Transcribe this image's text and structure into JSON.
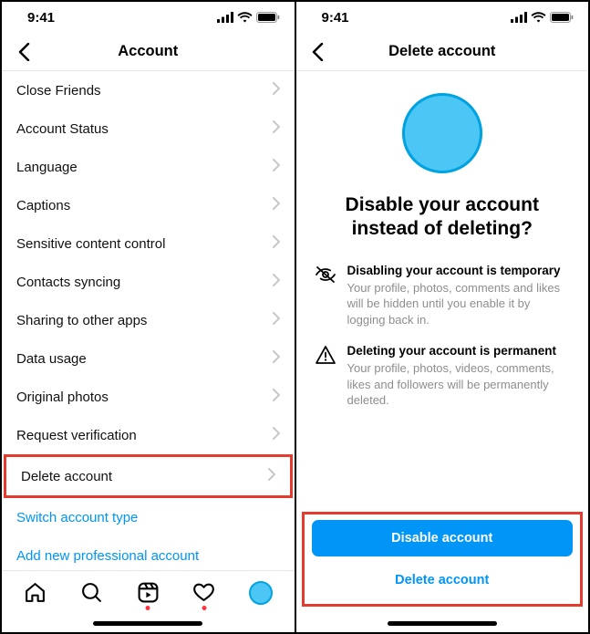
{
  "status": {
    "time": "9:41"
  },
  "left": {
    "title": "Account",
    "items": [
      {
        "label": "Close Friends",
        "hl": false
      },
      {
        "label": "Account Status",
        "hl": false
      },
      {
        "label": "Language",
        "hl": false
      },
      {
        "label": "Captions",
        "hl": false
      },
      {
        "label": "Sensitive content control",
        "hl": false
      },
      {
        "label": "Contacts syncing",
        "hl": false
      },
      {
        "label": "Sharing to other apps",
        "hl": false
      },
      {
        "label": "Data usage",
        "hl": false
      },
      {
        "label": "Original photos",
        "hl": false
      },
      {
        "label": "Request verification",
        "hl": false
      },
      {
        "label": "Delete account",
        "hl": true
      }
    ],
    "links": [
      {
        "label": "Switch account type"
      },
      {
        "label": "Add new professional account"
      }
    ]
  },
  "right": {
    "title": "Delete account",
    "heading": "Disable your account instead of deleting?",
    "info1_h": "Disabling your account is temporary",
    "info1_p": "Your profile, photos, comments and likes will be hidden until you enable it by logging back in.",
    "info2_h": "Deleting your account is permanent",
    "info2_p": "Your profile, photos, videos, comments, likes and followers will be permanently deleted.",
    "primary": "Disable account",
    "secondary": "Delete account"
  }
}
